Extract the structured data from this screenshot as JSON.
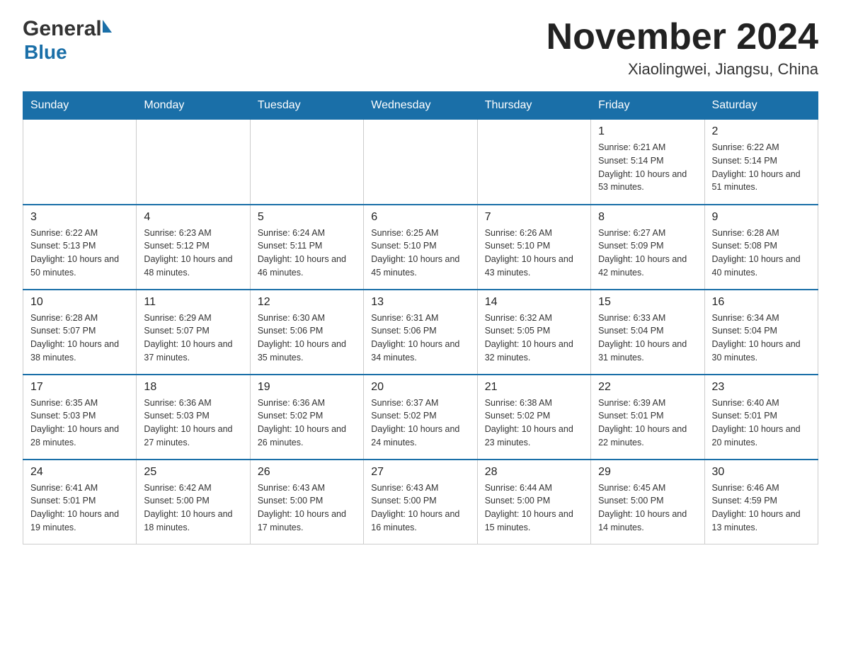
{
  "header": {
    "logo_general": "General",
    "logo_blue": "Blue",
    "month_title": "November 2024",
    "location": "Xiaolingwei, Jiangsu, China"
  },
  "weekdays": [
    "Sunday",
    "Monday",
    "Tuesday",
    "Wednesday",
    "Thursday",
    "Friday",
    "Saturday"
  ],
  "weeks": [
    [
      {
        "day": "",
        "info": ""
      },
      {
        "day": "",
        "info": ""
      },
      {
        "day": "",
        "info": ""
      },
      {
        "day": "",
        "info": ""
      },
      {
        "day": "",
        "info": ""
      },
      {
        "day": "1",
        "info": "Sunrise: 6:21 AM\nSunset: 5:14 PM\nDaylight: 10 hours and 53 minutes."
      },
      {
        "day": "2",
        "info": "Sunrise: 6:22 AM\nSunset: 5:14 PM\nDaylight: 10 hours and 51 minutes."
      }
    ],
    [
      {
        "day": "3",
        "info": "Sunrise: 6:22 AM\nSunset: 5:13 PM\nDaylight: 10 hours and 50 minutes."
      },
      {
        "day": "4",
        "info": "Sunrise: 6:23 AM\nSunset: 5:12 PM\nDaylight: 10 hours and 48 minutes."
      },
      {
        "day": "5",
        "info": "Sunrise: 6:24 AM\nSunset: 5:11 PM\nDaylight: 10 hours and 46 minutes."
      },
      {
        "day": "6",
        "info": "Sunrise: 6:25 AM\nSunset: 5:10 PM\nDaylight: 10 hours and 45 minutes."
      },
      {
        "day": "7",
        "info": "Sunrise: 6:26 AM\nSunset: 5:10 PM\nDaylight: 10 hours and 43 minutes."
      },
      {
        "day": "8",
        "info": "Sunrise: 6:27 AM\nSunset: 5:09 PM\nDaylight: 10 hours and 42 minutes."
      },
      {
        "day": "9",
        "info": "Sunrise: 6:28 AM\nSunset: 5:08 PM\nDaylight: 10 hours and 40 minutes."
      }
    ],
    [
      {
        "day": "10",
        "info": "Sunrise: 6:28 AM\nSunset: 5:07 PM\nDaylight: 10 hours and 38 minutes."
      },
      {
        "day": "11",
        "info": "Sunrise: 6:29 AM\nSunset: 5:07 PM\nDaylight: 10 hours and 37 minutes."
      },
      {
        "day": "12",
        "info": "Sunrise: 6:30 AM\nSunset: 5:06 PM\nDaylight: 10 hours and 35 minutes."
      },
      {
        "day": "13",
        "info": "Sunrise: 6:31 AM\nSunset: 5:06 PM\nDaylight: 10 hours and 34 minutes."
      },
      {
        "day": "14",
        "info": "Sunrise: 6:32 AM\nSunset: 5:05 PM\nDaylight: 10 hours and 32 minutes."
      },
      {
        "day": "15",
        "info": "Sunrise: 6:33 AM\nSunset: 5:04 PM\nDaylight: 10 hours and 31 minutes."
      },
      {
        "day": "16",
        "info": "Sunrise: 6:34 AM\nSunset: 5:04 PM\nDaylight: 10 hours and 30 minutes."
      }
    ],
    [
      {
        "day": "17",
        "info": "Sunrise: 6:35 AM\nSunset: 5:03 PM\nDaylight: 10 hours and 28 minutes."
      },
      {
        "day": "18",
        "info": "Sunrise: 6:36 AM\nSunset: 5:03 PM\nDaylight: 10 hours and 27 minutes."
      },
      {
        "day": "19",
        "info": "Sunrise: 6:36 AM\nSunset: 5:02 PM\nDaylight: 10 hours and 26 minutes."
      },
      {
        "day": "20",
        "info": "Sunrise: 6:37 AM\nSunset: 5:02 PM\nDaylight: 10 hours and 24 minutes."
      },
      {
        "day": "21",
        "info": "Sunrise: 6:38 AM\nSunset: 5:02 PM\nDaylight: 10 hours and 23 minutes."
      },
      {
        "day": "22",
        "info": "Sunrise: 6:39 AM\nSunset: 5:01 PM\nDaylight: 10 hours and 22 minutes."
      },
      {
        "day": "23",
        "info": "Sunrise: 6:40 AM\nSunset: 5:01 PM\nDaylight: 10 hours and 20 minutes."
      }
    ],
    [
      {
        "day": "24",
        "info": "Sunrise: 6:41 AM\nSunset: 5:01 PM\nDaylight: 10 hours and 19 minutes."
      },
      {
        "day": "25",
        "info": "Sunrise: 6:42 AM\nSunset: 5:00 PM\nDaylight: 10 hours and 18 minutes."
      },
      {
        "day": "26",
        "info": "Sunrise: 6:43 AM\nSunset: 5:00 PM\nDaylight: 10 hours and 17 minutes."
      },
      {
        "day": "27",
        "info": "Sunrise: 6:43 AM\nSunset: 5:00 PM\nDaylight: 10 hours and 16 minutes."
      },
      {
        "day": "28",
        "info": "Sunrise: 6:44 AM\nSunset: 5:00 PM\nDaylight: 10 hours and 15 minutes."
      },
      {
        "day": "29",
        "info": "Sunrise: 6:45 AM\nSunset: 5:00 PM\nDaylight: 10 hours and 14 minutes."
      },
      {
        "day": "30",
        "info": "Sunrise: 6:46 AM\nSunset: 4:59 PM\nDaylight: 10 hours and 13 minutes."
      }
    ]
  ]
}
